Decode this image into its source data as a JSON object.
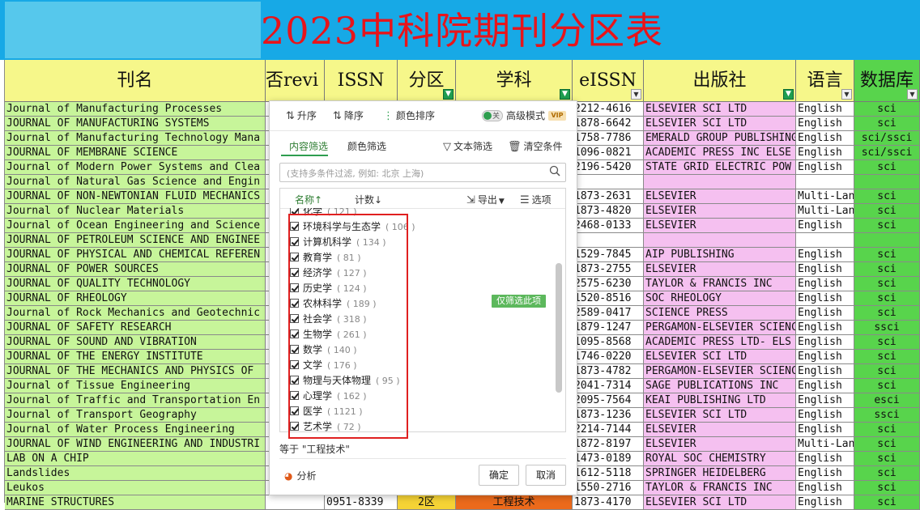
{
  "title": "2023中科院期刊分区表",
  "headers": {
    "name": "刊名",
    "review": "否revi",
    "issn": "ISSN",
    "zone": "分区",
    "subject": "学科",
    "eissn": "eISSN",
    "publisher": "出版社",
    "language": "语言",
    "database": "数据库"
  },
  "rows": [
    {
      "name": "Journal of Manufacturing Processes",
      "eissn": "2212-4616",
      "pub": "ELSEVIER SCI LTD",
      "lang": "English",
      "db": "sci"
    },
    {
      "name": "JOURNAL OF MANUFACTURING SYSTEMS",
      "eissn": "1878-6642",
      "pub": "ELSEVIER SCI LTD",
      "lang": "English",
      "db": "sci"
    },
    {
      "name": "Journal of Manufacturing Technology Mana",
      "eissn": "1758-7786",
      "pub": "EMERALD GROUP PUBLISHING",
      "lang": "English",
      "db": "sci/ssci"
    },
    {
      "name": "JOURNAL OF MEMBRANE SCIENCE",
      "eissn": "1096-0821",
      "pub": "ACADEMIC PRESS INC ELSE",
      "lang": "English",
      "db": "sci/ssci"
    },
    {
      "name": "Journal of Modern Power Systems and Clea",
      "eissn": "2196-5420",
      "pub": "STATE GRID ELECTRIC POW",
      "lang": "English",
      "db": "sci"
    },
    {
      "name": "Journal of Natural Gas Science and Engin",
      "eissn": "",
      "pub": "",
      "lang": "",
      "db": ""
    },
    {
      "name": "JOURNAL OF NON-NEWTONIAN FLUID MECHANICS",
      "eissn": "1873-2631",
      "pub": "ELSEVIER",
      "lang": "Multi-Lan",
      "db": "sci"
    },
    {
      "name": "Journal of Nuclear Materials",
      "eissn": "1873-4820",
      "pub": "ELSEVIER",
      "lang": "Multi-Lan",
      "db": "sci"
    },
    {
      "name": "Journal of Ocean Engineering and Science",
      "eissn": "2468-0133",
      "pub": "ELSEVIER",
      "lang": "English",
      "db": "sci"
    },
    {
      "name": "JOURNAL OF PETROLEUM SCIENCE AND ENGINEE",
      "eissn": "",
      "pub": "",
      "lang": "",
      "db": ""
    },
    {
      "name": "JOURNAL OF PHYSICAL AND CHEMICAL REFEREN",
      "eissn": "1529-7845",
      "pub": "AIP PUBLISHING",
      "lang": "English",
      "db": "sci"
    },
    {
      "name": "JOURNAL OF POWER SOURCES",
      "eissn": "1873-2755",
      "pub": "ELSEVIER",
      "lang": "English",
      "db": "sci"
    },
    {
      "name": "JOURNAL OF QUALITY TECHNOLOGY",
      "eissn": "2575-6230",
      "pub": "TAYLOR & FRANCIS INC",
      "lang": "English",
      "db": "sci"
    },
    {
      "name": "JOURNAL OF RHEOLOGY",
      "eissn": "1520-8516",
      "pub": "SOC RHEOLOGY",
      "lang": "English",
      "db": "sci"
    },
    {
      "name": "Journal of Rock Mechanics and Geotechnic",
      "eissn": "2589-0417",
      "pub": "SCIENCE PRESS",
      "lang": "English",
      "db": "sci"
    },
    {
      "name": "JOURNAL OF SAFETY RESEARCH",
      "eissn": "1879-1247",
      "pub": "PERGAMON-ELSEVIER SCIENC",
      "lang": "English",
      "db": "ssci"
    },
    {
      "name": "JOURNAL OF SOUND AND VIBRATION",
      "eissn": "1095-8568",
      "pub": "ACADEMIC PRESS LTD- ELS",
      "lang": "English",
      "db": "sci"
    },
    {
      "name": "JOURNAL OF THE ENERGY INSTITUTE",
      "eissn": "1746-0220",
      "pub": "ELSEVIER SCI LTD",
      "lang": "English",
      "db": "sci"
    },
    {
      "name": "JOURNAL OF THE MECHANICS AND PHYSICS OF",
      "eissn": "1873-4782",
      "pub": "PERGAMON-ELSEVIER SCIENC",
      "lang": "English",
      "db": "sci"
    },
    {
      "name": "Journal of Tissue Engineering",
      "eissn": "2041-7314",
      "pub": "SAGE PUBLICATIONS INC",
      "lang": "English",
      "db": "sci"
    },
    {
      "name": "Journal of Traffic and Transportation En",
      "eissn": "2095-7564",
      "pub": "KEAI PUBLISHING LTD",
      "lang": "English",
      "db": "esci"
    },
    {
      "name": "Journal of Transport Geography",
      "eissn": "1873-1236",
      "pub": "ELSEVIER SCI LTD",
      "lang": "English",
      "db": "ssci"
    },
    {
      "name": "Journal of Water Process Engineering",
      "eissn": "2214-7144",
      "pub": "ELSEVIER",
      "lang": "English",
      "db": "sci"
    },
    {
      "name": "JOURNAL OF WIND ENGINEERING AND INDUSTRI",
      "eissn": "1872-8197",
      "pub": "ELSEVIER",
      "lang": "Multi-Lan",
      "db": "sci"
    },
    {
      "name": "LAB ON A CHIP",
      "eissn": "1473-0189",
      "pub": "ROYAL SOC CHEMISTRY",
      "lang": "English",
      "db": "sci"
    },
    {
      "name": "Landslides",
      "eissn": "1612-5118",
      "pub": "SPRINGER HEIDELBERG",
      "lang": "English",
      "db": "sci"
    },
    {
      "name": "Leukos",
      "eissn": "1550-2716",
      "pub": "TAYLOR & FRANCIS INC",
      "lang": "English",
      "db": "sci"
    },
    {
      "name": "MARINE STRUCTURES",
      "issn": "0951-8339",
      "zone": "2区",
      "subject": "工程技术",
      "eissn": "1873-4170",
      "pub": "ELSEVIER SCI LTD",
      "lang": "English",
      "db": "sci"
    }
  ],
  "popup": {
    "sort_asc": "升序",
    "sort_desc": "降序",
    "sort_color": "颜色排序",
    "toggle_label": "关",
    "advanced": "高级模式",
    "vip": "VIP",
    "tab_content": "内容筛选",
    "tab_color": "颜色筛选",
    "text_filter": "文本筛选",
    "clear": "清空条件",
    "search_placeholder": "(支持多条件过滤, 例如: 北京 上海)",
    "col_name": "名称↑",
    "col_count": "计数↓",
    "export": "导出",
    "options": "选项",
    "only_this": "仅筛选此项",
    "items": [
      {
        "label": "化学",
        "count": "( 121 )"
      },
      {
        "label": "环境科学与生态学",
        "count": "( 106 )"
      },
      {
        "label": "计算机科学",
        "count": "( 134 )"
      },
      {
        "label": "教育学",
        "count": "( 81 )"
      },
      {
        "label": "经济学",
        "count": "( 127 )"
      },
      {
        "label": "历史学",
        "count": "( 124 )"
      },
      {
        "label": "农林科学",
        "count": "( 189 )"
      },
      {
        "label": "社会学",
        "count": "( 318 )"
      },
      {
        "label": "生物学",
        "count": "( 261 )"
      },
      {
        "label": "数学",
        "count": "( 140 )"
      },
      {
        "label": "文学",
        "count": "( 176 )"
      },
      {
        "label": "物理与天体物理",
        "count": "( 95 )"
      },
      {
        "label": "心理学",
        "count": "( 162 )"
      },
      {
        "label": "医学",
        "count": "( 1121 )"
      },
      {
        "label": "艺术学",
        "count": "( 72 )"
      }
    ],
    "equals_text": "等于 \"工程技术\"",
    "analyze": "分析",
    "ok": "确定",
    "cancel": "取消"
  }
}
